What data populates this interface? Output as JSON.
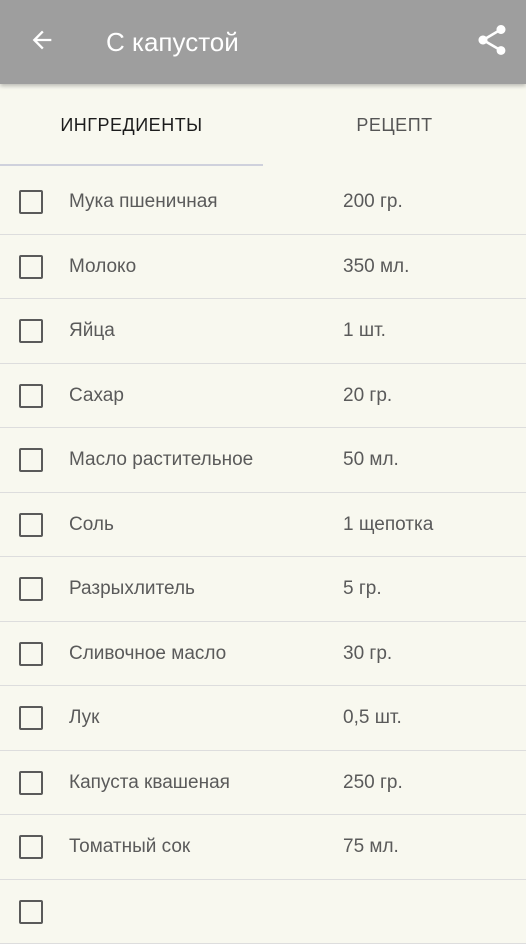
{
  "appbar": {
    "title": "С капустой",
    "back_icon": "arrow-back-icon",
    "share_icon": "share-icon",
    "background": "#9e9e9e"
  },
  "tabs": [
    {
      "label": "ИНГРЕДИЕНТЫ",
      "selected": true
    },
    {
      "label": "РЕЦЕПТ",
      "selected": false
    }
  ],
  "ingredients": [
    {
      "name": "Мука пшеничная",
      "qty": "200 гр.",
      "checked": false
    },
    {
      "name": "Молоко",
      "qty": "350 мл.",
      "checked": false
    },
    {
      "name": "Яйца",
      "qty": "1 шт.",
      "checked": false
    },
    {
      "name": "Сахар",
      "qty": "20 гр.",
      "checked": false
    },
    {
      "name": "Масло растительное",
      "qty": "50 мл.",
      "checked": false
    },
    {
      "name": "Соль",
      "qty": "1 щепотка",
      "checked": false
    },
    {
      "name": "Разрыхлитель",
      "qty": "5 гр.",
      "checked": false
    },
    {
      "name": "Сливочное масло",
      "qty": "30 гр.",
      "checked": false
    },
    {
      "name": "Лук",
      "qty": "0,5 шт.",
      "checked": false
    },
    {
      "name": "Капуста квашеная",
      "qty": "250 гр.",
      "checked": false
    },
    {
      "name": "Томатный сок",
      "qty": "75 мл.",
      "checked": false
    },
    {
      "name": "",
      "qty": "",
      "checked": false
    }
  ]
}
